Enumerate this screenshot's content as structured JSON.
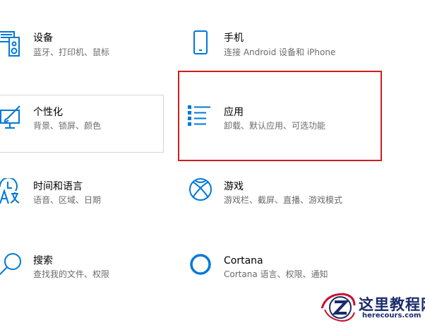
{
  "accent_color": "#0078d7",
  "highlight_color": "#cc1f1f",
  "tiles": [
    {
      "id": "devices",
      "title": "设备",
      "desc": "蓝牙、打印机、鼠标",
      "icon": "devices-icon"
    },
    {
      "id": "phone",
      "title": "手机",
      "desc": "连接 Android 设备和 iPhone",
      "icon": "phone-icon"
    },
    {
      "id": "personalization",
      "title": "个性化",
      "desc": "背景、锁屏、颜色",
      "icon": "personalization-icon"
    },
    {
      "id": "apps",
      "title": "应用",
      "desc": "卸载、默认应用、可选功能",
      "icon": "apps-icon"
    },
    {
      "id": "time-language",
      "title": "时间和语言",
      "desc": "语音、区域、日期",
      "icon": "time-language-icon"
    },
    {
      "id": "gaming",
      "title": "游戏",
      "desc": "游戏栏、截屏、直播、游戏模式",
      "icon": "xbox-icon"
    },
    {
      "id": "search",
      "title": "搜索",
      "desc": "查找我的文件、权限",
      "icon": "search-icon"
    },
    {
      "id": "cortana",
      "title": "Cortana",
      "desc": "Cortana 语言、权限、通知",
      "icon": "cortana-icon"
    }
  ],
  "watermark": {
    "text": "这里教程网",
    "url": "herecours.com",
    "icon": "z-logo-icon"
  }
}
